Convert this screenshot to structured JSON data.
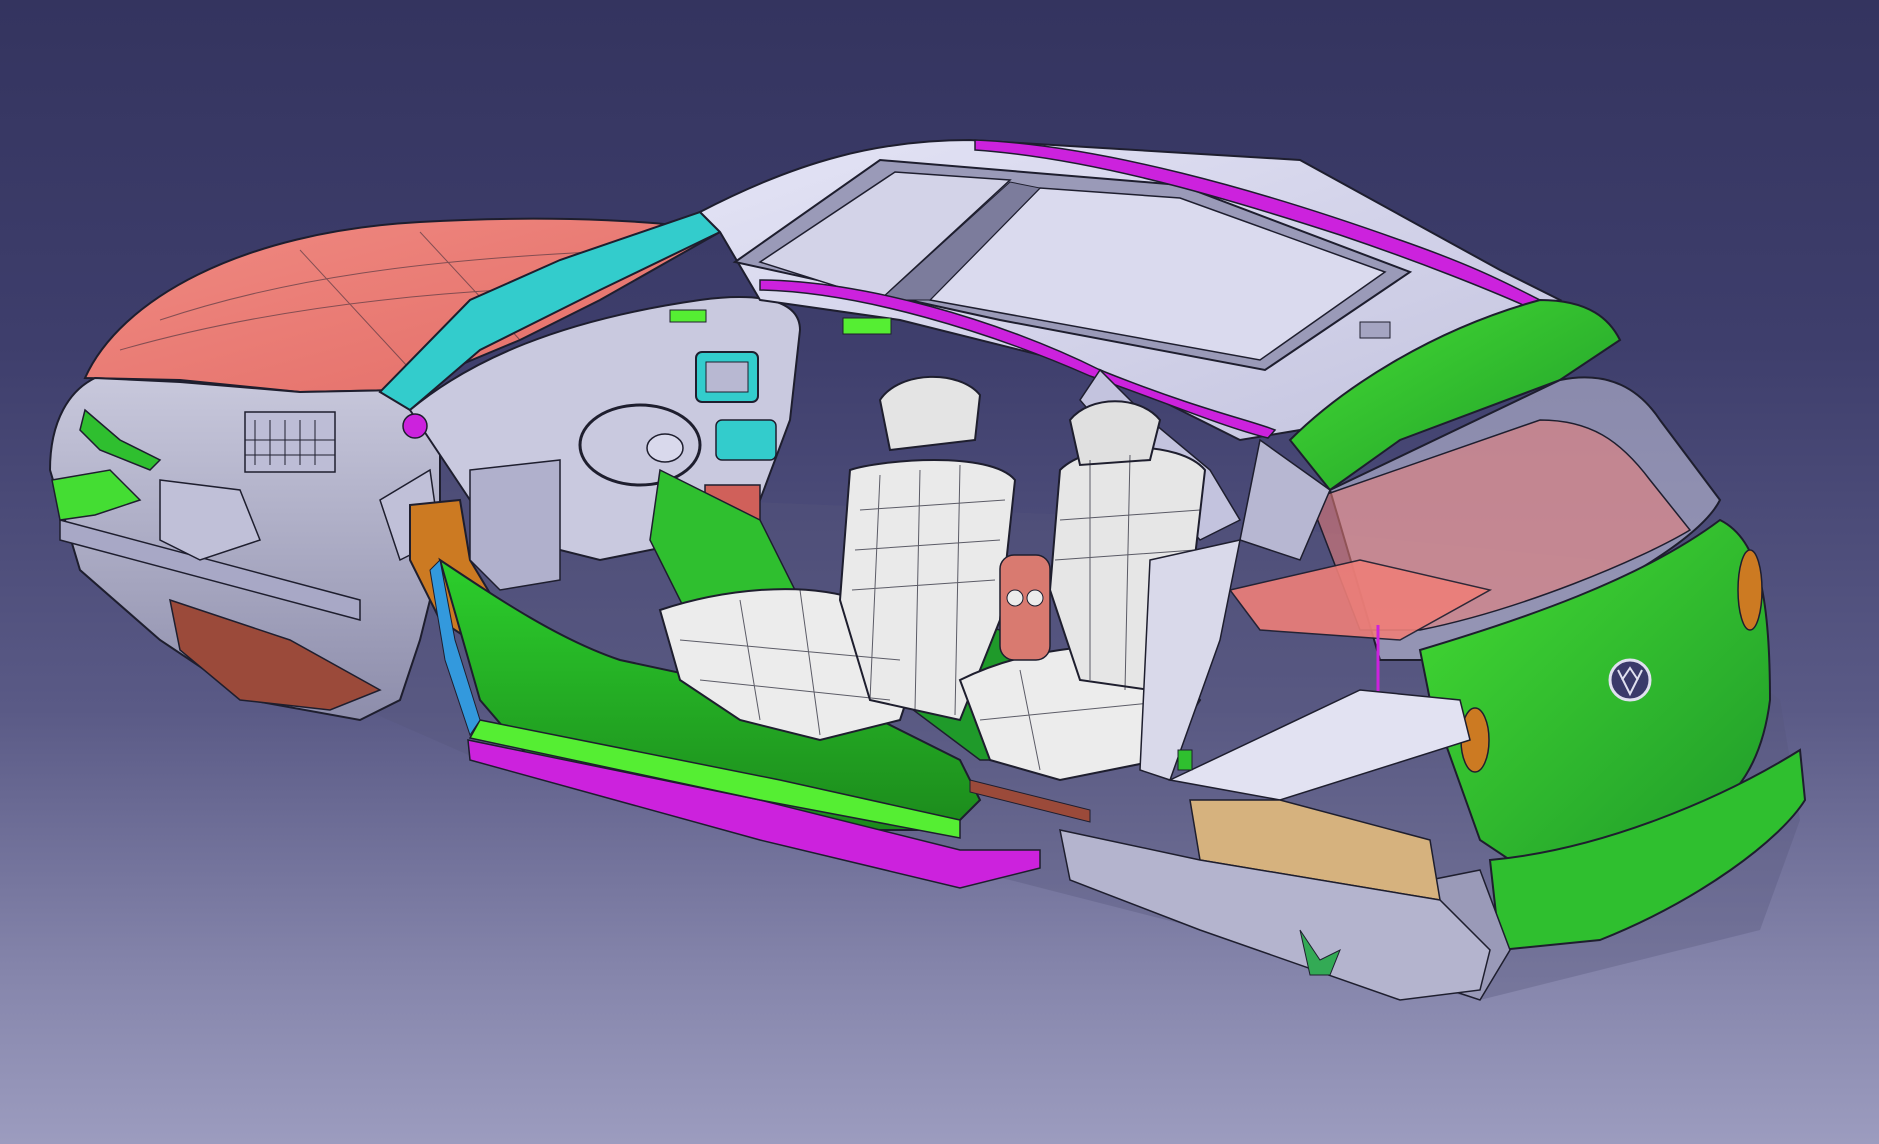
{
  "viewport": {
    "background_top": "#34345f",
    "background_bottom": "#9c9cbf"
  },
  "model": {
    "icon": "car-body-cutaway-3d-model-icon",
    "colors": {
      "body": "#d6d6ee",
      "body_shade": "#b7b7d2",
      "body_dark": "#9a9ab8",
      "edge": "#1e1e2e",
      "green": "#2fbf2f",
      "green_bright": "#55ee33",
      "magenta": "#cc22dd",
      "salmon": "#ee7f79",
      "cyan": "#33cccc",
      "orange": "#cc7a22",
      "tan": "#d6b27e",
      "rust": "#9b4a3a",
      "seat": "#ececec"
    }
  }
}
